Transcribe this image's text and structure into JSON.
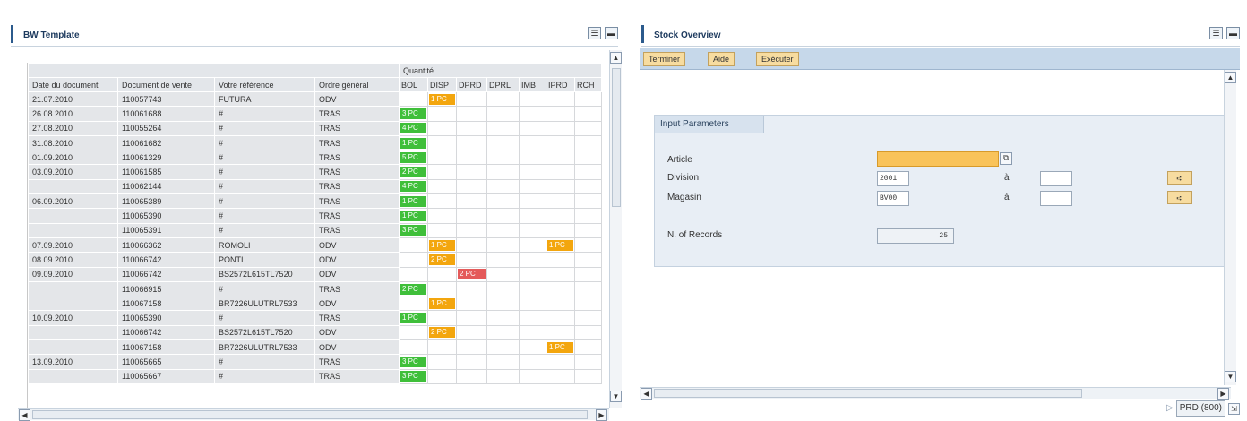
{
  "left_panel": {
    "title": "BW Template",
    "quantity_header": "Quantité",
    "columns": [
      "Date du document",
      "Document de vente",
      "Votre référence",
      "Ordre général"
    ],
    "sort_icon": "-",
    "qty_columns": [
      "BOL",
      "DISP",
      "DPRD",
      "DPRL",
      "IMB",
      "IPRD",
      "RCH"
    ],
    "rows": [
      {
        "date": "21.07.2010",
        "doc": "110057743",
        "ref": "FUTURA",
        "ordre": "ODV",
        "q": [
          "",
          "1 PC",
          "",
          "",
          "",
          "",
          ""
        ],
        "c": [
          "",
          "o",
          "",
          "",
          "",
          "",
          ""
        ]
      },
      {
        "date": "26.08.2010",
        "doc": "110061688",
        "ref": "#",
        "ordre": "TRAS",
        "q": [
          "3 PC",
          "",
          "",
          "",
          "",
          "",
          ""
        ],
        "c": [
          "g",
          "",
          "",
          "",
          "",
          "",
          ""
        ]
      },
      {
        "date": "27.08.2010",
        "doc": "110055264",
        "ref": "#",
        "ordre": "TRAS",
        "q": [
          "4 PC",
          "",
          "",
          "",
          "",
          "",
          ""
        ],
        "c": [
          "g",
          "",
          "",
          "",
          "",
          "",
          ""
        ]
      },
      {
        "date": "31.08.2010",
        "doc": "110061682",
        "ref": "#",
        "ordre": "TRAS",
        "q": [
          "1 PC",
          "",
          "",
          "",
          "",
          "",
          ""
        ],
        "c": [
          "g",
          "",
          "",
          "",
          "",
          "",
          ""
        ]
      },
      {
        "date": "01.09.2010",
        "doc": "110061329",
        "ref": "#",
        "ordre": "TRAS",
        "q": [
          "5 PC",
          "",
          "",
          "",
          "",
          "",
          ""
        ],
        "c": [
          "g",
          "",
          "",
          "",
          "",
          "",
          ""
        ]
      },
      {
        "date": "03.09.2010",
        "doc": "110061585",
        "ref": "#",
        "ordre": "TRAS",
        "q": [
          "2 PC",
          "",
          "",
          "",
          "",
          "",
          ""
        ],
        "c": [
          "g",
          "",
          "",
          "",
          "",
          "",
          ""
        ]
      },
      {
        "date": "",
        "doc": "110062144",
        "ref": "#",
        "ordre": "TRAS",
        "q": [
          "4 PC",
          "",
          "",
          "",
          "",
          "",
          ""
        ],
        "c": [
          "g",
          "",
          "",
          "",
          "",
          "",
          ""
        ]
      },
      {
        "date": "06.09.2010",
        "doc": "110065389",
        "ref": "#",
        "ordre": "TRAS",
        "q": [
          "1 PC",
          "",
          "",
          "",
          "",
          "",
          ""
        ],
        "c": [
          "g",
          "",
          "",
          "",
          "",
          "",
          ""
        ]
      },
      {
        "date": "",
        "doc": "110065390",
        "ref": "#",
        "ordre": "TRAS",
        "q": [
          "1 PC",
          "",
          "",
          "",
          "",
          "",
          ""
        ],
        "c": [
          "g",
          "",
          "",
          "",
          "",
          "",
          ""
        ]
      },
      {
        "date": "",
        "doc": "110065391",
        "ref": "#",
        "ordre": "TRAS",
        "q": [
          "3 PC",
          "",
          "",
          "",
          "",
          "",
          ""
        ],
        "c": [
          "g",
          "",
          "",
          "",
          "",
          "",
          ""
        ]
      },
      {
        "date": "07.09.2010",
        "doc": "110066362",
        "ref": "ROMOLI",
        "ordre": "ODV",
        "q": [
          "",
          "1 PC",
          "",
          "",
          "",
          "1 PC",
          ""
        ],
        "c": [
          "",
          "o",
          "",
          "",
          "",
          "o",
          ""
        ]
      },
      {
        "date": "08.09.2010",
        "doc": "110066742",
        "ref": "PONTI",
        "ordre": "ODV",
        "q": [
          "",
          "2 PC",
          "",
          "",
          "",
          "",
          ""
        ],
        "c": [
          "",
          "o",
          "",
          "",
          "",
          "",
          ""
        ]
      },
      {
        "date": "09.09.2010",
        "doc": "110066742",
        "ref": "BS2572L615TL7520",
        "ordre": "ODV",
        "q": [
          "",
          "",
          "2 PC",
          "",
          "",
          "",
          ""
        ],
        "c": [
          "",
          "",
          "r",
          "",
          "",
          "",
          ""
        ]
      },
      {
        "date": "",
        "doc": "110066915",
        "ref": "#",
        "ordre": "TRAS",
        "q": [
          "2 PC",
          "",
          "",
          "",
          "",
          "",
          ""
        ],
        "c": [
          "g",
          "",
          "",
          "",
          "",
          "",
          ""
        ]
      },
      {
        "date": "",
        "doc": "110067158",
        "ref": "BR7226ULUTRL7533",
        "ordre": "ODV",
        "q": [
          "",
          "1 PC",
          "",
          "",
          "",
          "",
          ""
        ],
        "c": [
          "",
          "o",
          "",
          "",
          "",
          "",
          ""
        ]
      },
      {
        "date": "10.09.2010",
        "doc": "110065390",
        "ref": "#",
        "ordre": "TRAS",
        "q": [
          "1 PC",
          "",
          "",
          "",
          "",
          "",
          ""
        ],
        "c": [
          "g",
          "",
          "",
          "",
          "",
          "",
          ""
        ]
      },
      {
        "date": "",
        "doc": "110066742",
        "ref": "BS2572L615TL7520",
        "ordre": "ODV",
        "q": [
          "",
          "2 PC",
          "",
          "",
          "",
          "",
          ""
        ],
        "c": [
          "",
          "o",
          "",
          "",
          "",
          "",
          ""
        ]
      },
      {
        "date": "",
        "doc": "110067158",
        "ref": "BR7226ULUTRL7533",
        "ordre": "ODV",
        "q": [
          "",
          "",
          "",
          "",
          "",
          "1 PC",
          ""
        ],
        "c": [
          "",
          "",
          "",
          "",
          "",
          "o",
          ""
        ]
      },
      {
        "date": "13.09.2010",
        "doc": "110065665",
        "ref": "#",
        "ordre": "TRAS",
        "q": [
          "3 PC",
          "",
          "",
          "",
          "",
          "",
          ""
        ],
        "c": [
          "g",
          "",
          "",
          "",
          "",
          "",
          ""
        ]
      },
      {
        "date": "",
        "doc": "110065667",
        "ref": "#",
        "ordre": "TRAS",
        "q": [
          "3 PC",
          "",
          "",
          "",
          "",
          "",
          ""
        ],
        "c": [
          "g",
          "",
          "",
          "",
          "",
          "",
          ""
        ]
      }
    ]
  },
  "right_panel": {
    "title": "Stock Overview",
    "buttons": {
      "terminer": "Terminer",
      "aide": "Aide",
      "executer": "Exécuter"
    },
    "group_title": "Input Parameters",
    "article_label": "Article",
    "article_value": "",
    "division_label": "Division",
    "division_value": "2001",
    "magasin_label": "Magasin",
    "magasin_value": "BV00",
    "a_label": "à",
    "records_label": "N. of Records",
    "records_value": "25",
    "status": "PRD (800)"
  },
  "colors": {
    "green": "#3fbf3a",
    "orange": "#f3a60e",
    "red": "#e45a5a",
    "article_field": "#f9c35a",
    "toolbar": "#c6d8ea"
  }
}
